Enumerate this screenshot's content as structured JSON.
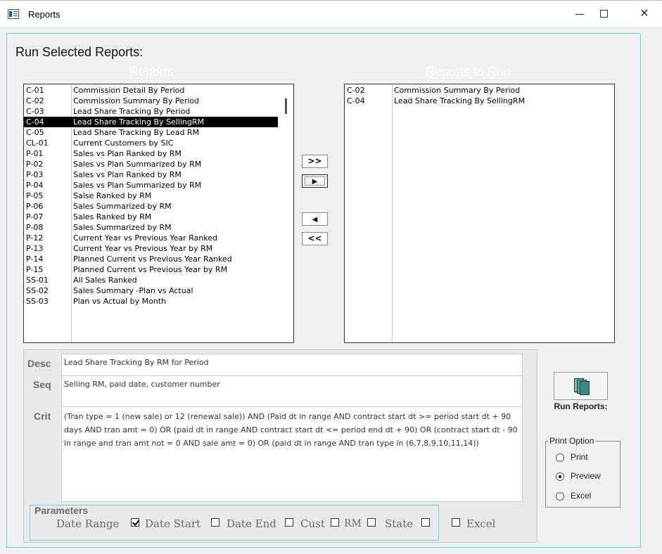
{
  "window": {
    "title": "Reports",
    "minimize_icon": "minimize-icon",
    "maximize_icon": "maximize-icon",
    "close_glyph": "✕"
  },
  "header": {
    "heading": "Run Selected Reports:",
    "reports_title": "Reports",
    "to_run_title": "Reports to Run"
  },
  "reports": [
    {
      "code": "C-01",
      "name": "Commission Detail By Period"
    },
    {
      "code": "C-02",
      "name": "Commission Summary By Period"
    },
    {
      "code": "C-03",
      "name": "Lead Share Tracking By Period"
    },
    {
      "code": "C-04",
      "name": "Lead Share Tracking By SellingRM",
      "selected": true
    },
    {
      "code": "C-05",
      "name": "Lead Share Tracking By Lead RM"
    },
    {
      "code": "CL-01",
      "name": "Current Customers by SIC"
    },
    {
      "code": "P-01",
      "name": "Sales vs Plan Ranked by RM"
    },
    {
      "code": "P-02",
      "name": "Sales vs Plan Summarized by RM"
    },
    {
      "code": "P-03",
      "name": "Sales vs Plan Ranked by RM"
    },
    {
      "code": "P-04",
      "name": "Sales vs Plan Summarized by RM"
    },
    {
      "code": "P-05",
      "name": "Salse Ranked by RM"
    },
    {
      "code": "P-06",
      "name": "Sales Summarized by RM"
    },
    {
      "code": "P-07",
      "name": "Sales Ranked by RM"
    },
    {
      "code": "P-08",
      "name": "Sales Summarized by RM"
    },
    {
      "code": "P-12",
      "name": "Current Year vs Previous Year Ranked"
    },
    {
      "code": "P-13",
      "name": "Current Year vs Previous Year by RM"
    },
    {
      "code": "P-14",
      "name": "Planned Current vs Previous Year Ranked"
    },
    {
      "code": "P-15",
      "name": "Planned Current vs Previous Year by RM"
    },
    {
      "code": "SS-01",
      "name": "All Sales Ranked"
    },
    {
      "code": "SS-02",
      "name": "Sales Summary -Plan vs Actual"
    },
    {
      "code": "SS-03",
      "name": "Plan vs Actual by Month"
    }
  ],
  "reports_to_run": [
    {
      "code": "C-02",
      "name": "Commission Summary By Period"
    },
    {
      "code": "C-04",
      "name": "Lead Share Tracking By SellingRM"
    }
  ],
  "move_buttons": {
    "add_all": ">>",
    "add_one": "▶",
    "remove_one": "◀",
    "remove_all": "<<"
  },
  "details": {
    "desc_label": "Desc",
    "desc_value": "Lead Share Tracking By RM for Period",
    "seq_label": "Seq",
    "seq_value": "Selling RM, paid date, customer number",
    "crit_label": "Crit",
    "crit_value": "(Tran type = 1 (new sale)  or 12 (renewal sale)) AND  (Paid dt in range AND contract start dt >= period start dt + 90 days AND tran amt = 0) OR (paid dt in range AND contract start dt <= period end dt + 90) OR (contract start dt - 90 in range and tran amt not = 0 AND sale amt = 0) OR (paid dt in range AND tran type in (6,7,8,9,10,11,14))"
  },
  "parameters": {
    "label": "Parameters",
    "date_range": "Date Range",
    "date_range_checked": true,
    "date_start": "Date Start",
    "date_start_checked": false,
    "date_end": "Date End",
    "date_end_checked": false,
    "cust": "Cust",
    "cust_checked": false,
    "rm": "RM",
    "rm_checked": false,
    "state": "State",
    "state_checked": false,
    "excel": "Excel",
    "excel_checked": false
  },
  "run": {
    "icon": "reports-icon",
    "label": "Run Reports:"
  },
  "print_option": {
    "legend": "Print Option",
    "options": [
      {
        "label": "Print",
        "checked": false
      },
      {
        "label": "Preview",
        "checked": true
      },
      {
        "label": "Excel",
        "checked": false
      }
    ]
  }
}
